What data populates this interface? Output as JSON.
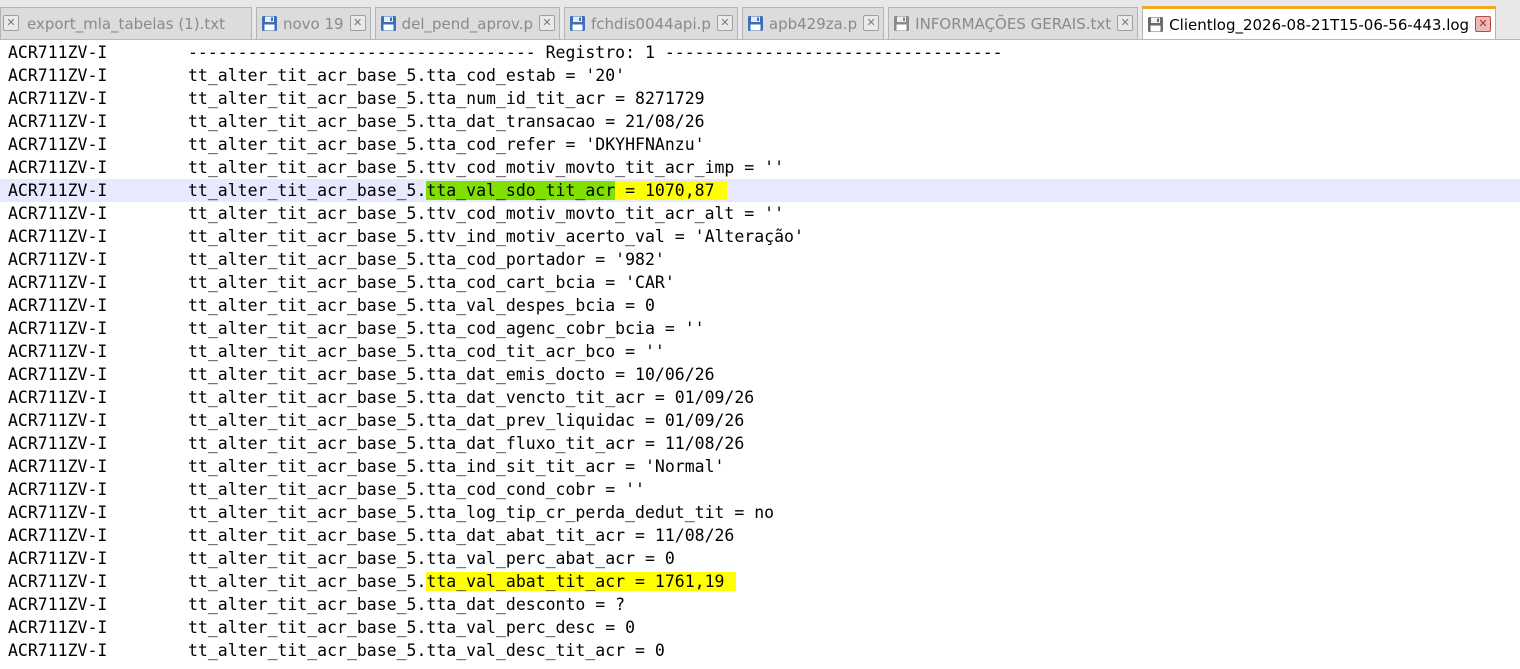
{
  "tabs": [
    {
      "label": "export_mla_tabelas (1).txt",
      "active": false
    },
    {
      "label": "novo 19",
      "active": false
    },
    {
      "label": "del_pend_aprov.p",
      "active": false
    },
    {
      "label": "fchdis0044api.p",
      "active": false
    },
    {
      "label": "apb429za.p",
      "active": false
    },
    {
      "label": "INFORMAÇÕES GERAIS.txt",
      "active": false
    },
    {
      "label": "Clientlog_2026-08-21T15-06-56-443.log",
      "active": true
    }
  ],
  "editor": {
    "prefix": "ACR711ZV-I",
    "lines": [
      {
        "body": "----------------------------------- Registro: 1 ----------------------------------"
      },
      {
        "pre": "tt_alter_tit_acr_base_5.",
        "body": "tta_cod_estab = '20'"
      },
      {
        "pre": "tt_alter_tit_acr_base_5.",
        "body": "tta_num_id_tit_acr = 8271729"
      },
      {
        "pre": "tt_alter_tit_acr_base_5.",
        "body": "tta_dat_transacao = 21/08/26"
      },
      {
        "pre": "tt_alter_tit_acr_base_5.",
        "body": "tta_cod_refer = 'DKYHFNAnzu'"
      },
      {
        "pre": "tt_alter_tit_acr_base_5.",
        "body": "ttv_cod_motiv_movto_tit_acr_imp = ''"
      },
      {
        "pre": "tt_alter_tit_acr_base_5.",
        "green": "tta_val_sdo_tit_acr",
        "yellow": " = 1070,87"
      },
      {
        "pre": "tt_alter_tit_acr_base_5.",
        "body": "ttv_cod_motiv_movto_tit_acr_alt = ''"
      },
      {
        "pre": "tt_alter_tit_acr_base_5.",
        "body": "ttv_ind_motiv_acerto_val = 'Alteração'"
      },
      {
        "pre": "tt_alter_tit_acr_base_5.",
        "body": "tta_cod_portador = '982'"
      },
      {
        "pre": "tt_alter_tit_acr_base_5.",
        "body": "tta_cod_cart_bcia = 'CAR'"
      },
      {
        "pre": "tt_alter_tit_acr_base_5.",
        "body": "tta_val_despes_bcia = 0"
      },
      {
        "pre": "tt_alter_tit_acr_base_5.",
        "body": "tta_cod_agenc_cobr_bcia = ''"
      },
      {
        "pre": "tt_alter_tit_acr_base_5.",
        "body": "tta_cod_tit_acr_bco = ''"
      },
      {
        "pre": "tt_alter_tit_acr_base_5.",
        "body": "tta_dat_emis_docto = 10/06/26"
      },
      {
        "pre": "tt_alter_tit_acr_base_5.",
        "body": "tta_dat_vencto_tit_acr = 01/09/26"
      },
      {
        "pre": "tt_alter_tit_acr_base_5.",
        "body": "tta_dat_prev_liquidac = 01/09/26"
      },
      {
        "pre": "tt_alter_tit_acr_base_5.",
        "body": "tta_dat_fluxo_tit_acr = 11/08/26"
      },
      {
        "pre": "tt_alter_tit_acr_base_5.",
        "body": "tta_ind_sit_tit_acr = 'Normal'"
      },
      {
        "pre": "tt_alter_tit_acr_base_5.",
        "body": "tta_cod_cond_cobr = ''"
      },
      {
        "pre": "tt_alter_tit_acr_base_5.",
        "body": "tta_log_tip_cr_perda_dedut_tit = no"
      },
      {
        "pre": "tt_alter_tit_acr_base_5.",
        "body": "tta_dat_abat_tit_acr = 11/08/26"
      },
      {
        "pre": "tt_alter_tit_acr_base_5.",
        "body": "tta_val_perc_abat_acr = 0"
      },
      {
        "pre": "tt_alter_tit_acr_base_5.",
        "yellow": "tta_val_abat_tit_acr = 1761,19"
      },
      {
        "pre": "tt_alter_tit_acr_base_5.",
        "body": "tta_dat_desconto = ?"
      },
      {
        "pre": "tt_alter_tit_acr_base_5.",
        "body": "tta_val_perc_desc = 0"
      },
      {
        "pre": "tt_alter_tit_acr_base_5.",
        "body": "tta_val_desc_tit_acr = 0"
      }
    ]
  },
  "colors": {
    "active_tab_accent": "#f5a623",
    "current_line": "#e8e8ff",
    "highlight_green": "#80e000",
    "highlight_yellow": "#ffff00"
  }
}
